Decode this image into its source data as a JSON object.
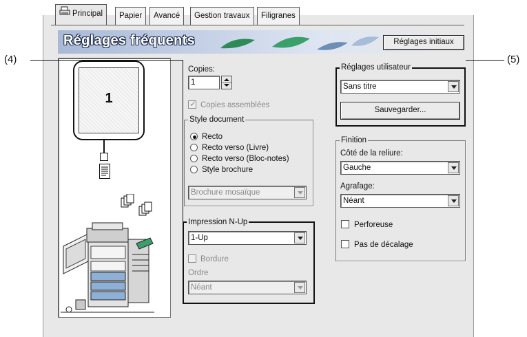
{
  "tabs": [
    {
      "label": "Principal",
      "active": true
    },
    {
      "label": "Papier"
    },
    {
      "label": "Avancé"
    },
    {
      "label": "Gestion travaux"
    },
    {
      "label": "Filigranes"
    }
  ],
  "banner": {
    "title": "Réglages fréquents",
    "reset_button": "Réglages initiaux"
  },
  "preview": {
    "page_number": "1"
  },
  "copies": {
    "label": "Copies:",
    "value": "1",
    "collated_label": "Copies assemblées",
    "collated_checked": true,
    "collated_disabled": true
  },
  "document_style": {
    "title": "Style document",
    "options": [
      "Recto",
      "Recto verso (Livre)",
      "Recto verso (Bloc-notes)",
      "Style brochure"
    ],
    "selected_index": 0,
    "brochure_select": "Brochure mosaïque"
  },
  "nup": {
    "title": "Impression N-Up",
    "value": "1-Up",
    "border_label": "Bordure",
    "order_label": "Ordre",
    "order_value": "Néant"
  },
  "user_settings": {
    "title": "Réglages utilisateur",
    "value": "Sans titre",
    "save_button": "Sauvegarder..."
  },
  "finishing": {
    "title": "Finition",
    "binding_label": "Côté de la reliure:",
    "binding_value": "Gauche",
    "stapling_label": "Agrafage:",
    "stapling_value": "Néant",
    "punch_label": "Perforeuse",
    "no_offset_label": "Pas de décalage"
  },
  "callouts": {
    "left": "(4)",
    "right": "(5)"
  }
}
